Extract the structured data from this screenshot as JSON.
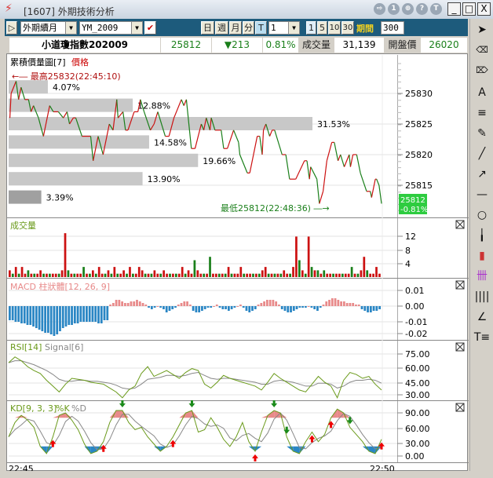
{
  "window": {
    "title": "[1607] 外期技術分析",
    "header_buttons": [
      "⇨",
      "1",
      "⊕",
      "?",
      "T"
    ],
    "controls": [
      "_",
      "□",
      "X"
    ]
  },
  "toolbar": {
    "play": "▷",
    "market_select": "外期續月",
    "symbol_select": "YM_2009",
    "period_buttons": [
      "日",
      "週",
      "月",
      "分",
      "T"
    ],
    "active_period": "T",
    "interval_select": "1",
    "interval_buttons": [
      "1",
      "5",
      "10",
      "30"
    ],
    "range_label": "期間",
    "range_value": "300"
  },
  "quote": {
    "name": "小道瓊指數202009",
    "last": "25812",
    "change": "▼213",
    "change_pct": "0.81%",
    "volume_label": "成交量",
    "volume": "31,139",
    "open_label": "開盤價",
    "open": "26020"
  },
  "colors": {
    "up": "#cc1111",
    "down": "#1a7f1a",
    "macd_pos": "#e88a8a",
    "macd_neg": "#2a86c4",
    "rsi": "#6a9a1a",
    "signal": "#888888",
    "toolbar": "#1d5b7c",
    "last_badge": "#2ecc40"
  },
  "chart_data": [
    {
      "type": "line",
      "title": "累積價量圖[7]",
      "series_label": "價格",
      "ylim": [
        25811,
        25834
      ],
      "yticks": [
        "25830",
        "25825",
        "25820",
        "25815"
      ],
      "high_label": "←― 最高25832(22:45:10)",
      "low_label": "最低25812(22:48:36) ―→",
      "last_badge": [
        "25812",
        "-0.81%"
      ],
      "price": [
        [
          1,
          25826
        ],
        [
          2,
          25830
        ],
        [
          6,
          25832
        ],
        [
          8,
          25829
        ],
        [
          10,
          25831
        ],
        [
          13,
          25829
        ],
        [
          16,
          25829
        ],
        [
          18,
          25827
        ],
        [
          20,
          25828
        ],
        [
          24,
          25826
        ],
        [
          28,
          25823
        ],
        [
          33,
          25828
        ],
        [
          36,
          25827
        ],
        [
          40,
          25827
        ],
        [
          44,
          25826
        ],
        [
          47,
          25827
        ],
        [
          49,
          25825
        ],
        [
          52,
          25826
        ],
        [
          54,
          25826
        ],
        [
          59,
          25823
        ],
        [
          66,
          25823
        ],
        [
          68,
          25819
        ],
        [
          72,
          25823
        ],
        [
          76,
          25820
        ],
        [
          81,
          25825
        ],
        [
          84,
          25824
        ],
        [
          87,
          25829
        ],
        [
          88,
          25826
        ],
        [
          92,
          25827
        ],
        [
          94,
          25824
        ],
        [
          96,
          25824
        ],
        [
          101,
          25827
        ],
        [
          104,
          25827
        ],
        [
          106,
          25829
        ],
        [
          109,
          25827
        ],
        [
          114,
          25824
        ],
        [
          117,
          25825
        ],
        [
          120,
          25827
        ],
        [
          126,
          25823
        ],
        [
          129,
          25823
        ],
        [
          133,
          25826
        ],
        [
          139,
          25829
        ],
        [
          141,
          25828
        ],
        [
          143,
          25829
        ],
        [
          147,
          25821
        ],
        [
          150,
          25821
        ],
        [
          155,
          25825
        ],
        [
          157,
          25824
        ],
        [
          159,
          25826
        ],
        [
          162,
          25824
        ],
        [
          163,
          25826
        ],
        [
          166,
          25824
        ],
        [
          171,
          25824
        ],
        [
          173,
          25821
        ],
        [
          176,
          25821
        ],
        [
          181,
          25824
        ],
        [
          185,
          25822
        ],
        [
          186,
          25820
        ],
        [
          192,
          25817
        ],
        [
          194,
          25817
        ],
        [
          197,
          25820
        ],
        [
          200,
          25823
        ],
        [
          202,
          25823
        ],
        [
          204,
          25820
        ],
        [
          205,
          25824
        ],
        [
          207,
          25825
        ],
        [
          210,
          25823
        ],
        [
          212,
          25824
        ],
        [
          214,
          25824
        ],
        [
          220,
          25820
        ],
        [
          223,
          25820
        ],
        [
          226,
          25816
        ],
        [
          231,
          25816
        ],
        [
          238,
          25819
        ],
        [
          240,
          25819
        ],
        [
          242,
          25816
        ],
        [
          243,
          25818
        ],
        [
          248,
          25816
        ],
        [
          250,
          25812
        ],
        [
          253,
          25814
        ],
        [
          256,
          25819
        ],
        [
          260,
          25822
        ],
        [
          262,
          25822
        ],
        [
          265,
          25819
        ],
        [
          267,
          25820
        ],
        [
          270,
          25818
        ],
        [
          274,
          25820
        ],
        [
          275,
          25818
        ],
        [
          277,
          25820
        ],
        [
          280,
          25820
        ],
        [
          283,
          25817
        ],
        [
          288,
          25814
        ],
        [
          291,
          25814
        ],
        [
          292,
          25813
        ],
        [
          295,
          25816
        ],
        [
          296,
          25816
        ],
        [
          298,
          25815
        ],
        [
          300,
          25812
        ]
      ],
      "volume_profile": [
        {
          "price": 25831,
          "pct": "4.07%",
          "value": 4.07
        },
        {
          "price": 25828,
          "pct": "12.88%",
          "value": 12.88
        },
        {
          "price": 25825,
          "pct": "31.53%",
          "value": 31.53
        },
        {
          "price": 25822,
          "pct": "14.58%",
          "value": 14.58
        },
        {
          "price": 25819,
          "pct": "19.66%",
          "value": 19.66
        },
        {
          "price": 25816,
          "pct": "13.90%",
          "value": 13.9
        },
        {
          "price": 25813,
          "pct": "3.39%",
          "value": 3.39
        }
      ]
    },
    {
      "type": "bar",
      "title": "成交量",
      "yticks": [
        "12",
        "8",
        "4"
      ],
      "ymax": 16,
      "values": [
        2,
        1,
        3,
        1,
        3,
        1,
        2,
        1,
        1,
        1,
        2,
        1,
        1,
        1,
        1,
        1,
        1,
        2,
        13,
        2,
        1,
        1,
        1,
        1,
        3,
        1,
        1,
        2,
        1,
        3,
        1,
        1,
        2,
        1,
        3,
        1,
        1,
        2,
        1,
        3,
        1,
        1,
        3,
        2,
        1,
        1,
        1,
        2,
        1,
        1,
        2,
        1,
        1,
        1,
        1,
        1,
        3,
        1,
        2,
        1,
        5,
        2,
        1,
        1,
        1,
        6,
        1,
        1,
        1,
        1,
        1,
        3,
        1,
        1,
        1,
        3,
        1,
        1,
        1,
        1,
        1,
        1,
        2,
        3,
        1,
        1,
        1,
        1,
        1,
        2,
        1,
        1,
        3,
        12,
        5,
        2,
        1,
        12,
        3,
        2,
        2,
        1,
        2,
        1,
        1,
        1,
        1,
        1,
        1,
        1,
        1,
        3,
        1,
        1,
        2,
        6,
        2,
        1,
        1,
        3,
        1
      ],
      "direction": "rgrgrrgrgrrgrgrrgrrgrgrrgrgrgrrgrgrgrrgrgrrrgrgrrgrrgrgrrgrrgrrgrgrrgrgrgrrrgrrgrgrrgrgrgrrgrrgrgrgrgrgrrgrrgrrgrgrrgrr"
    },
    {
      "type": "bar",
      "title": "MACD 柱狀體[12, 26, 9]",
      "yticks": [
        "0.01",
        "0.00",
        "-0.01",
        "-0.02"
      ],
      "unit": 0.001,
      "values": [
        -9,
        -9,
        -10,
        -10,
        -11,
        -11,
        -12,
        -12,
        -13,
        -14,
        -15,
        -16,
        -17,
        -17,
        -18,
        -19,
        -18,
        -16,
        -14,
        -13,
        -12,
        -12,
        -11,
        -11,
        -10,
        -10,
        -10,
        -10,
        -10,
        -10,
        -11,
        -11,
        -9,
        -9,
        1,
        2,
        4,
        4,
        3,
        2,
        2,
        3,
        3,
        4,
        3,
        2,
        1,
        -1,
        -2,
        -1,
        0,
        -1,
        -2,
        -4,
        -3,
        -2,
        -1,
        1,
        2,
        3,
        3,
        1,
        -3,
        -4,
        -4,
        -3,
        -2,
        -1,
        -1,
        0,
        1,
        -1,
        -2,
        -2,
        -3,
        -2,
        -1,
        0,
        1,
        -1,
        -3,
        -4,
        -3,
        -2,
        1,
        2,
        3,
        4,
        4,
        4,
        3,
        1,
        -2,
        -3,
        -4,
        -4,
        -3,
        -2,
        -1,
        -1,
        -1,
        0,
        -1,
        -2,
        -3,
        -1,
        1,
        3,
        4,
        5,
        5,
        4,
        3,
        3,
        2,
        2,
        2,
        1,
        1,
        -2,
        -3,
        -4,
        -4,
        -3,
        -3,
        -2
      ]
    },
    {
      "type": "line",
      "title": "RSI[14]",
      "signal_label": "Signal[6]",
      "yticks": [
        "75.00",
        "60.00",
        "45.00",
        "30.00"
      ],
      "rsi": [
        66,
        72,
        68,
        62,
        58,
        55,
        48,
        42,
        36,
        44,
        50,
        49,
        48,
        46,
        45,
        44,
        40,
        36,
        30,
        38,
        42,
        55,
        62,
        52,
        55,
        58,
        54,
        50,
        56,
        60,
        58,
        44,
        40,
        46,
        53,
        50,
        48,
        46,
        44,
        42,
        38,
        46,
        55,
        50,
        46,
        42,
        38,
        36,
        44,
        52,
        46,
        42,
        30,
        48,
        56,
        54,
        50,
        52,
        44,
        38
      ],
      "signal": [
        66,
        68,
        68,
        66,
        64,
        61,
        58,
        54,
        49,
        47,
        47,
        48,
        48,
        47,
        47,
        46,
        45,
        43,
        40,
        39,
        40,
        44,
        49,
        50,
        51,
        53,
        53,
        52,
        53,
        55,
        56,
        53,
        50,
        49,
        50,
        50,
        49,
        48,
        47,
        46,
        44,
        44,
        47,
        48,
        47,
        46,
        44,
        42,
        42,
        45,
        45,
        44,
        40,
        42,
        46,
        48,
        48,
        49,
        48,
        45
      ]
    },
    {
      "type": "line",
      "title": "KD[9, 3, 3]",
      "k_label": "%K",
      "d_label": "%D",
      "yticks": [
        "90.00",
        "60.00",
        "30.00",
        "0.00"
      ],
      "k": [
        40,
        70,
        85,
        75,
        60,
        20,
        5,
        40,
        85,
        90,
        75,
        55,
        25,
        5,
        10,
        30,
        70,
        95,
        95,
        70,
        55,
        60,
        40,
        25,
        10,
        20,
        40,
        65,
        90,
        95,
        50,
        55,
        80,
        60,
        35,
        20,
        40,
        70,
        30,
        10,
        50,
        85,
        95,
        90,
        40,
        10,
        5,
        30,
        50,
        30,
        45,
        80,
        98,
        90,
        60,
        45,
        30,
        10,
        5,
        35
      ],
      "d": [
        40,
        55,
        65,
        77,
        73,
        52,
        28,
        22,
        43,
        72,
        83,
        73,
        52,
        28,
        13,
        15,
        35,
        65,
        87,
        87,
        73,
        62,
        52,
        42,
        25,
        18,
        23,
        42,
        65,
        83,
        78,
        67,
        62,
        65,
        58,
        38,
        32,
        43,
        47,
        37,
        30,
        48,
        77,
        90,
        75,
        47,
        18,
        15,
        28,
        37,
        42,
        52,
        74,
        89,
        83,
        65,
        45,
        28,
        15,
        17
      ],
      "buy_signals": [
        7,
        15,
        26,
        39,
        48,
        51,
        59
      ],
      "sell_signals": [
        18,
        29,
        42,
        44,
        54
      ]
    }
  ],
  "time_axis": {
    "start": "22:45",
    "end": "22:50"
  }
}
